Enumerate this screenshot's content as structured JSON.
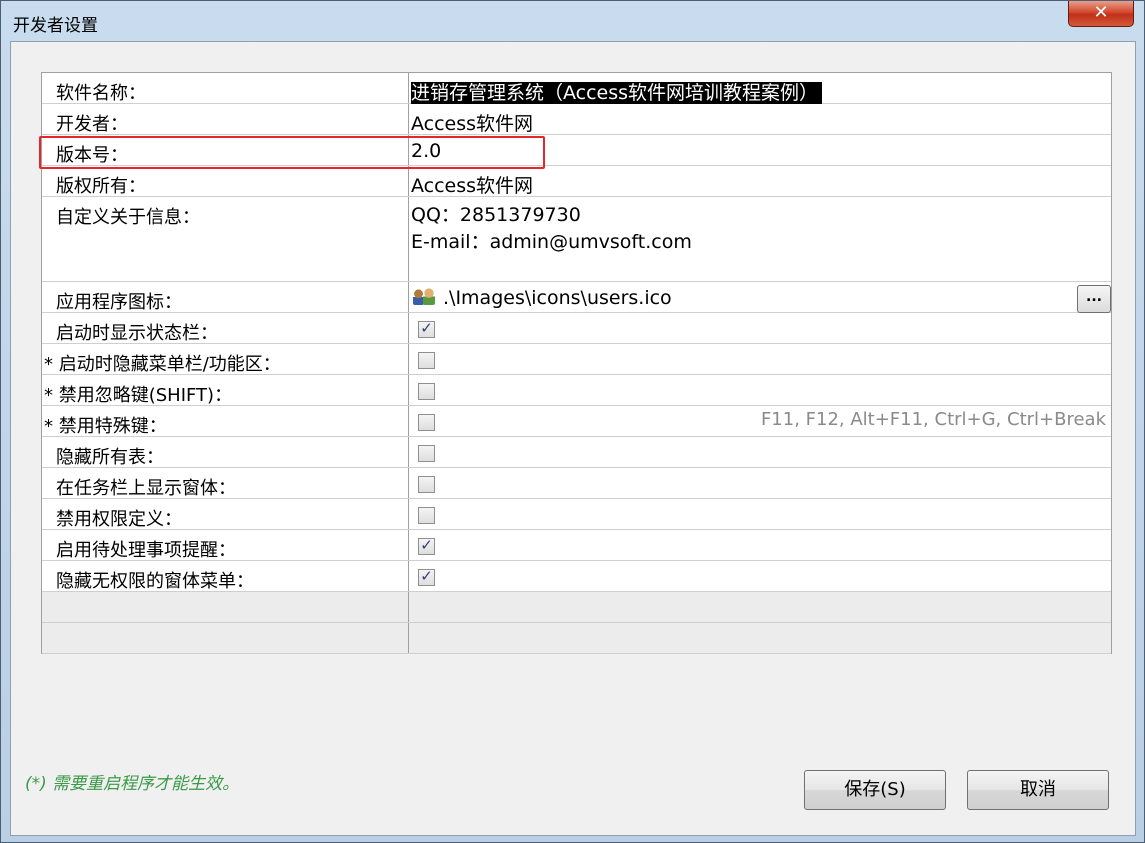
{
  "window": {
    "title": "开发者设置",
    "close_label": "✕"
  },
  "properties": [
    {
      "label": "软件名称：",
      "value": "进销存管理系统（Access软件网培训教程案例）"
    },
    {
      "label": "开发者：",
      "value": "Access软件网"
    },
    {
      "label": "版本号：",
      "value": "2.0"
    },
    {
      "label": "版权所有：",
      "value": "Access软件网"
    },
    {
      "label": "自定义关于信息：",
      "lines": [
        "QQ：2851379730",
        "E-mail：admin@umvsoft.com"
      ]
    },
    {
      "label": "应用程序图标：",
      "value": ".\\Images\\icons\\users.ico",
      "icon": "users-icon",
      "browse_label": "..."
    },
    {
      "label": "启动时显示状态栏：",
      "checked": true
    },
    {
      "label": "* 启动时隐藏菜单栏/功能区：",
      "checked": false
    },
    {
      "label": "* 禁用忽略键(SHIFT)：",
      "checked": false
    },
    {
      "label": "* 禁用特殊键：",
      "checked": false,
      "hint": "F11, F12, Alt+F11, Ctrl+G, Ctrl+Break"
    },
    {
      "label": "隐藏所有表：",
      "checked": false
    },
    {
      "label": "在任务栏上显示窗体：",
      "checked": false
    },
    {
      "label": "禁用权限定义：",
      "checked": false
    },
    {
      "label": "启用待处理事项提醒：",
      "checked": true
    },
    {
      "label": "隐藏无权限的窗体菜单：",
      "checked": true
    }
  ],
  "check_mark": "✓",
  "footer": {
    "note": "(*) 需要重启程序才能生效。",
    "save_label": "保存(S)",
    "cancel_label": "取消"
  },
  "colors": {
    "highlight_box": "#e8262a",
    "note_text": "#3b9a48",
    "title_bar": "#c9dcef"
  }
}
